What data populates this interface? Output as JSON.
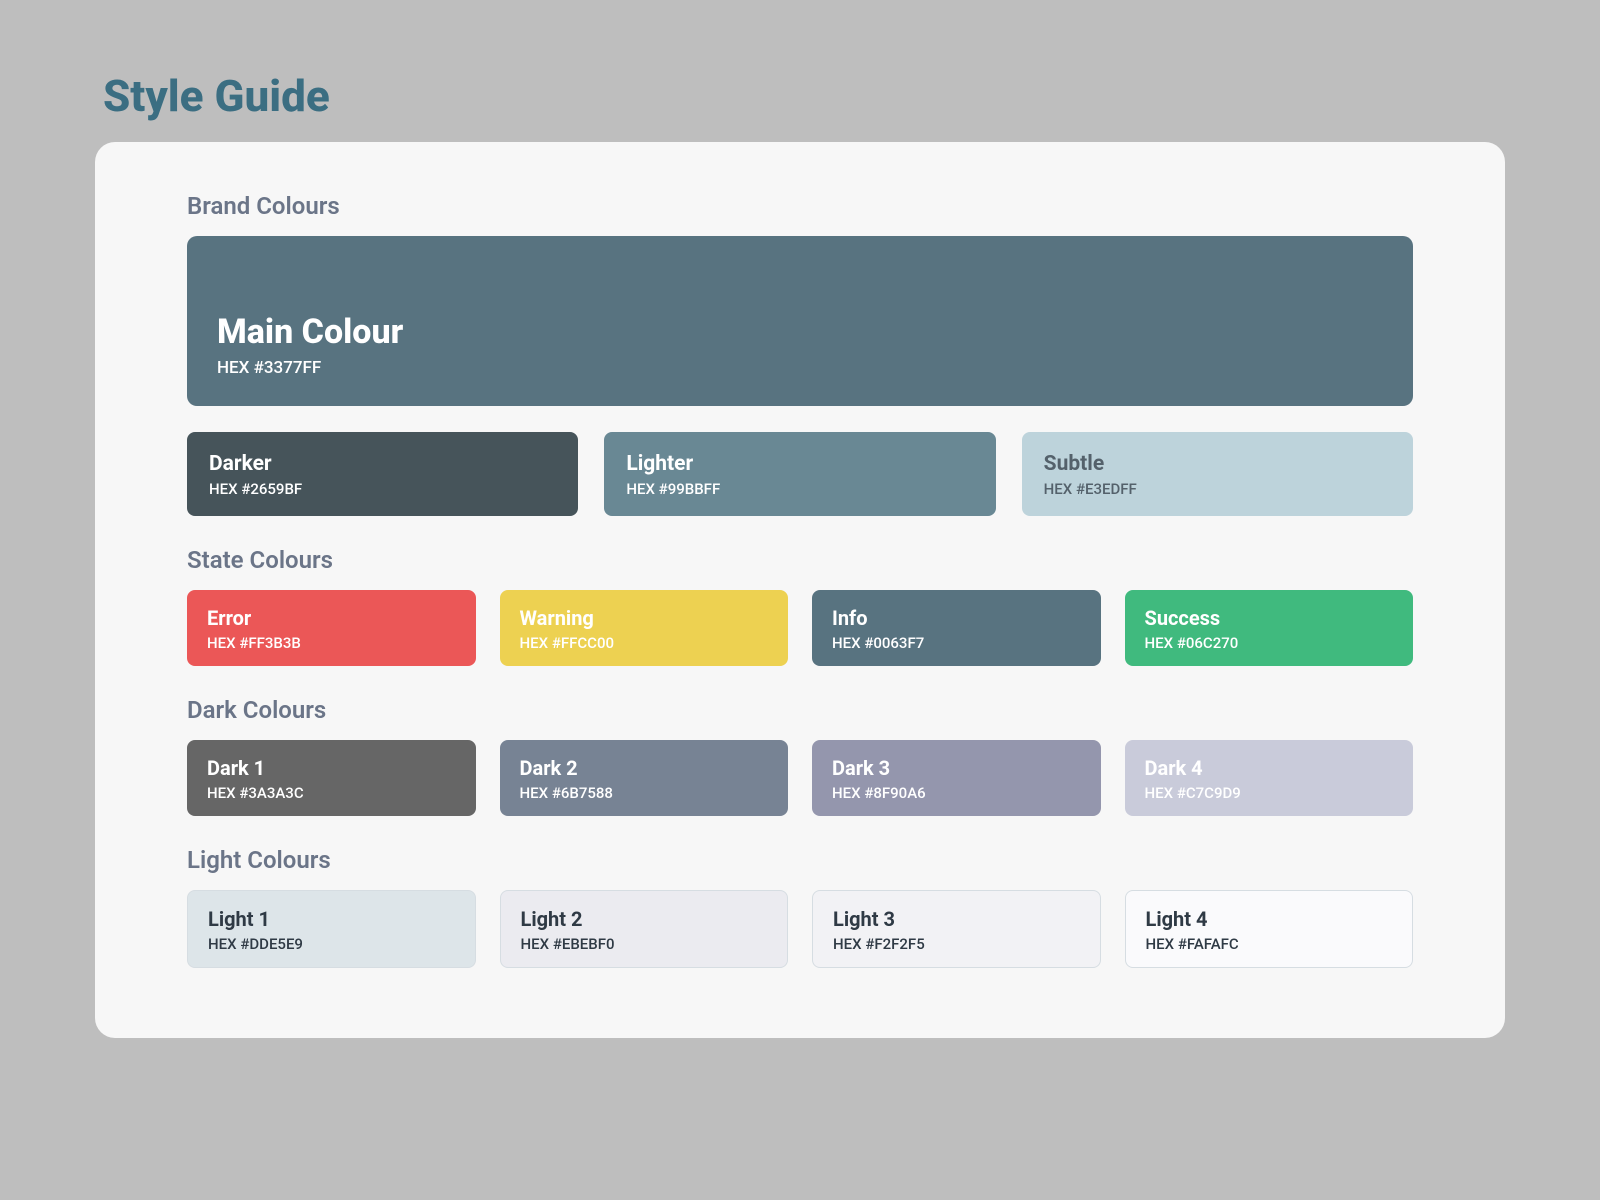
{
  "page_title": "Style Guide",
  "sections": {
    "brand": {
      "title": "Brand Colours",
      "main": {
        "name": "Main Colour",
        "hex": "HEX #3377FF",
        "bg": "#587380"
      },
      "variants": [
        {
          "name": "Darker",
          "hex": "HEX #2659BF",
          "bg": "#46545A",
          "text": "light"
        },
        {
          "name": "Lighter",
          "hex": "HEX #99BBFF",
          "bg": "#698894",
          "text": "light"
        },
        {
          "name": "Subtle",
          "hex": "HEX #E3EDFF",
          "bg": "#BDD3DB",
          "text": "muted"
        }
      ]
    },
    "state": {
      "title": "State Colours",
      "items": [
        {
          "name": "Error",
          "hex": "HEX #FF3B3B",
          "bg": "#EB5757",
          "text": "light"
        },
        {
          "name": "Warning",
          "hex": "HEX #FFCC00",
          "bg": "#EDD151",
          "text": "light"
        },
        {
          "name": "Info",
          "hex": "HEX #0063F7",
          "bg": "#587380",
          "text": "light"
        },
        {
          "name": "Success",
          "hex": "HEX #06C270",
          "bg": "#40BA7E",
          "text": "light"
        }
      ]
    },
    "dark": {
      "title": "Dark Colours",
      "items": [
        {
          "name": "Dark 1",
          "hex": "HEX #3A3A3C",
          "bg": "#666666",
          "text": "light"
        },
        {
          "name": "Dark 2",
          "hex": "HEX #6B7588",
          "bg": "#778394",
          "text": "light"
        },
        {
          "name": "Dark 3",
          "hex": "HEX #8F90A6",
          "bg": "#9496AD",
          "text": "light"
        },
        {
          "name": "Dark 4",
          "hex": "HEX #C7C9D9",
          "bg": "#C9CBDA",
          "text": "light"
        }
      ]
    },
    "light": {
      "title": "Light Colours",
      "items": [
        {
          "name": "Light 1",
          "hex": "HEX #DDE5E9",
          "bg": "#DDE5E9",
          "text": "dark",
          "border": true
        },
        {
          "name": "Light 2",
          "hex": "HEX #EBEBF0",
          "bg": "#EBEBF0",
          "text": "dark",
          "border": true
        },
        {
          "name": "Light 3",
          "hex": "HEX #F2F2F5",
          "bg": "#F2F2F5",
          "text": "dark",
          "border": true
        },
        {
          "name": "Light 4",
          "hex": "HEX #FAFAFC",
          "bg": "#FAFAFC",
          "text": "dark",
          "border": true
        }
      ]
    }
  }
}
